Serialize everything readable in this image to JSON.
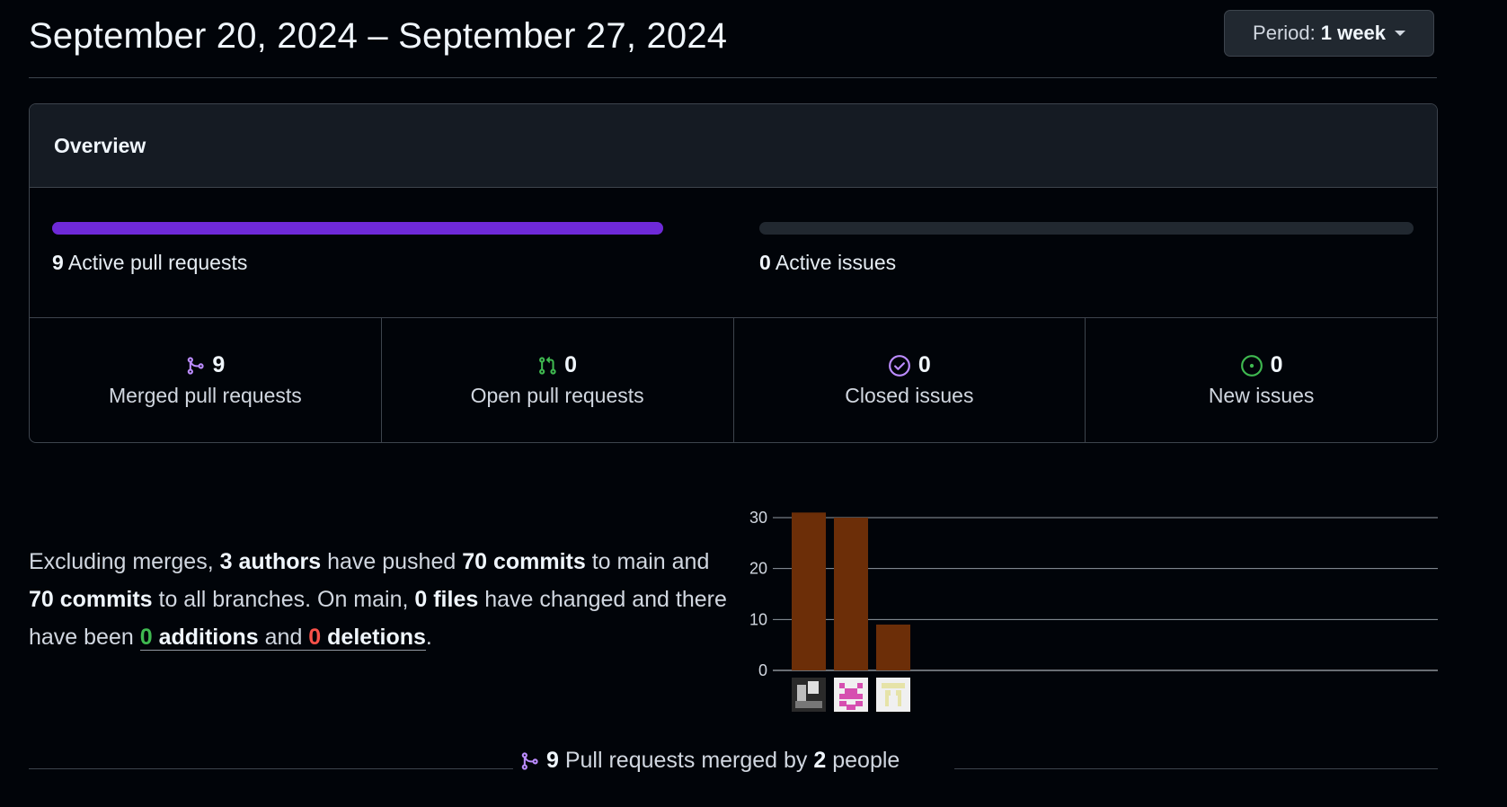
{
  "header": {
    "date_range": "September 20, 2024 – September 27, 2024",
    "period_prefix": "Period:",
    "period_value": "1 week"
  },
  "overview": {
    "title": "Overview",
    "active_prs": {
      "count": "9",
      "label": "Active pull requests",
      "fill_fraction": 1.0,
      "color": "#6e29d8"
    },
    "active_issues": {
      "count": "0",
      "label": "Active issues",
      "fill_fraction": 0.0
    },
    "stats": [
      {
        "icon": "git-merge-icon",
        "color": "#bc8cff",
        "count": "9",
        "label": "Merged pull requests"
      },
      {
        "icon": "git-pull-request-icon",
        "color": "#3fb950",
        "count": "0",
        "label": "Open pull requests"
      },
      {
        "icon": "issue-closed-icon",
        "color": "#bc8cff",
        "count": "0",
        "label": "Closed issues"
      },
      {
        "icon": "issue-opened-icon",
        "color": "#3fb950",
        "count": "0",
        "label": "New issues"
      }
    ]
  },
  "summary": {
    "t1": "Excluding merges, ",
    "authors": "3 authors",
    "t2": " have pushed ",
    "commits_main": "70 commits",
    "t3": " to main and ",
    "commits_all": "70 commits",
    "t4": " to all branches. On main, ",
    "files": "0 files",
    "t5": " have changed and there have been ",
    "additions_count": "0",
    "additions_label": " additions",
    "t6": " and ",
    "deletions_count": "0",
    "deletions_label": " deletions",
    "t7": "."
  },
  "chart_data": {
    "type": "bar",
    "categories": [
      "author-1",
      "author-2",
      "author-3"
    ],
    "values": [
      31,
      30,
      9
    ],
    "ylim": [
      0,
      30
    ],
    "yticks": [
      "0",
      "10",
      "20",
      "30"
    ],
    "bar_color": "#6c2e08",
    "grid": true,
    "x_tick_avatars": [
      "photo-avatar",
      "pink-pixel-avatar",
      "yellow-pixel-avatar"
    ]
  },
  "footer": {
    "count": "9",
    "text1": " Pull requests merged by ",
    "people": "2",
    "text2": " people"
  }
}
